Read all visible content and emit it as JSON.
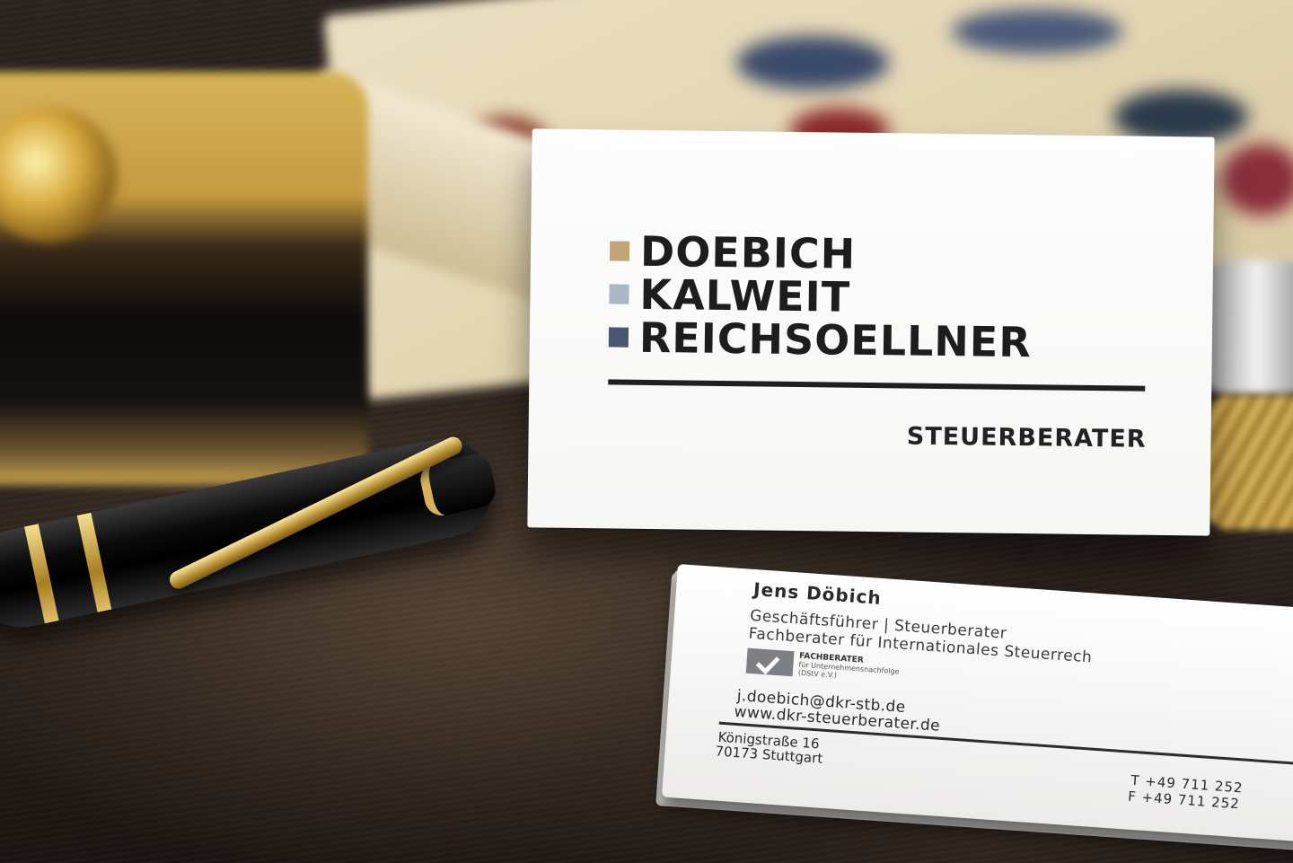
{
  "front_card": {
    "logo_lines": [
      "DOEBICH",
      "KALWEIT",
      "REICHSOELLNER"
    ],
    "logo_colors": [
      "#c2a577",
      "#a9b6c4",
      "#4b5672"
    ],
    "tagline": "STEUERBERATER"
  },
  "back_card": {
    "name": "Jens Döbich",
    "role": "Geschäftsführer | Steuerberater",
    "specialty": "Fachberater für Internationales Steuerrech",
    "badge": {
      "title": "FACHBERATER",
      "line1": "für Unternehmensnachfolge",
      "line2": "(DStV e.V.)"
    },
    "email": "j.doebich@dkr-stb.de",
    "website": "www.dkr-steuerberater.de",
    "street": "Königstraße 16",
    "city": "70173 Stuttgart",
    "phone": "T +49 711 252",
    "fax": "F +49 711 252"
  },
  "colors": {
    "desk": "#241d19",
    "card": "#fdfdfd",
    "gold": "#c59a3f",
    "text": "#1d1d1f"
  }
}
